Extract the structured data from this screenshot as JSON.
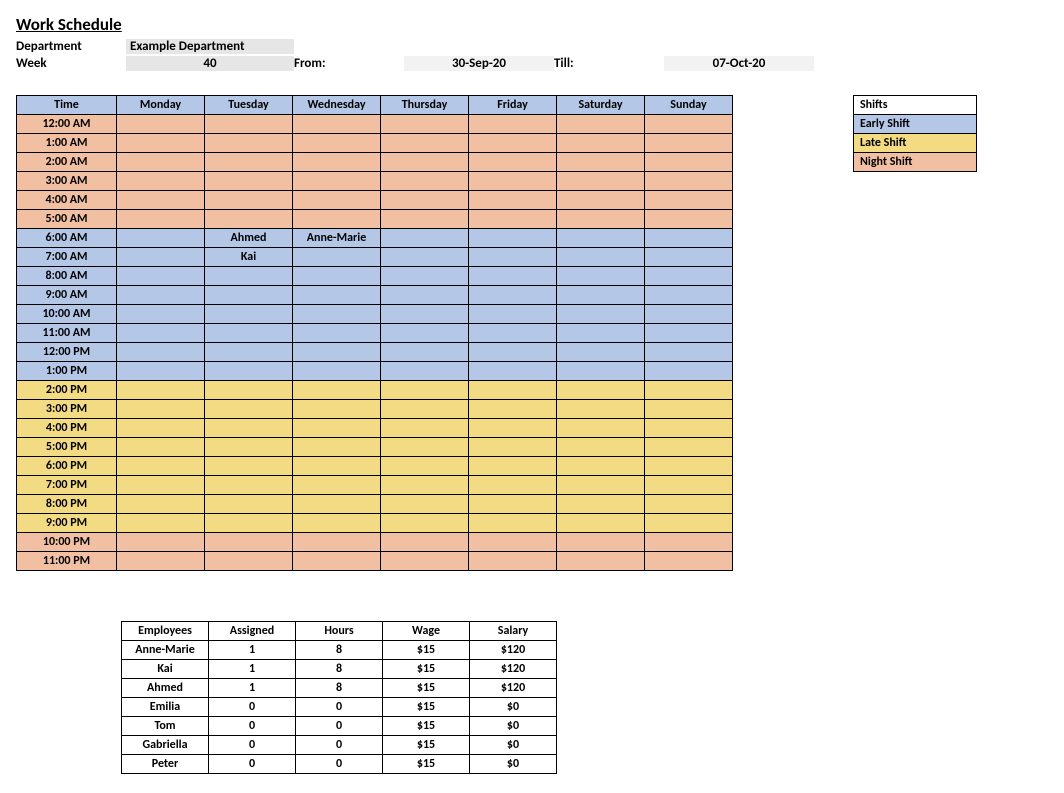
{
  "title": "Work Schedule",
  "meta": {
    "dept_label": "Department",
    "dept_value": "Example Department",
    "week_label": "Week",
    "week_value": "40",
    "from_label": "From:",
    "from_value": "30-Sep-20",
    "till_label": "Till:",
    "till_value": "07-Oct-20"
  },
  "shift_colors": {
    "early": "c-early",
    "late": "c-late",
    "night": "c-night"
  },
  "time_shifts": [
    "night",
    "night",
    "night",
    "night",
    "night",
    "night",
    "early",
    "early",
    "early",
    "early",
    "early",
    "early",
    "early",
    "early",
    "late",
    "late",
    "late",
    "late",
    "late",
    "late",
    "late",
    "late",
    "night",
    "night"
  ],
  "schedule": {
    "headers": [
      "Time",
      "Monday",
      "Tuesday",
      "Wednesday",
      "Thursday",
      "Friday",
      "Saturday",
      "Sunday"
    ],
    "times": [
      "12:00 AM",
      "1:00 AM",
      "2:00 AM",
      "3:00 AM",
      "4:00 AM",
      "5:00 AM",
      "6:00 AM",
      "7:00 AM",
      "8:00 AM",
      "9:00 AM",
      "10:00 AM",
      "11:00 AM",
      "12:00 PM",
      "1:00 PM",
      "2:00 PM",
      "3:00 PM",
      "4:00 PM",
      "5:00 PM",
      "6:00 PM",
      "7:00 PM",
      "8:00 PM",
      "9:00 PM",
      "10:00 PM",
      "11:00 PM"
    ],
    "cells": {
      "6": {
        "2": "Ahmed",
        "3": "Anne-Marie"
      },
      "7": {
        "2": "Kai"
      }
    }
  },
  "legend": {
    "title": "Shifts",
    "items": [
      {
        "label": "Early Shift",
        "class": "c-early"
      },
      {
        "label": "Late Shift",
        "class": "c-late"
      },
      {
        "label": "Night Shift",
        "class": "c-night"
      }
    ]
  },
  "employees": {
    "headers": [
      "Employees",
      "Assigned",
      "Hours",
      "Wage",
      "Salary"
    ],
    "rows": [
      [
        "Anne-Marie",
        "1",
        "8",
        "$15",
        "$120"
      ],
      [
        "Kai",
        "1",
        "8",
        "$15",
        "$120"
      ],
      [
        "Ahmed",
        "1",
        "8",
        "$15",
        "$120"
      ],
      [
        "Emilia",
        "0",
        "0",
        "$15",
        "$0"
      ],
      [
        "Tom",
        "0",
        "0",
        "$15",
        "$0"
      ],
      [
        "Gabriella",
        "0",
        "0",
        "$15",
        "$0"
      ],
      [
        "Peter",
        "0",
        "0",
        "$15",
        "$0"
      ]
    ]
  }
}
